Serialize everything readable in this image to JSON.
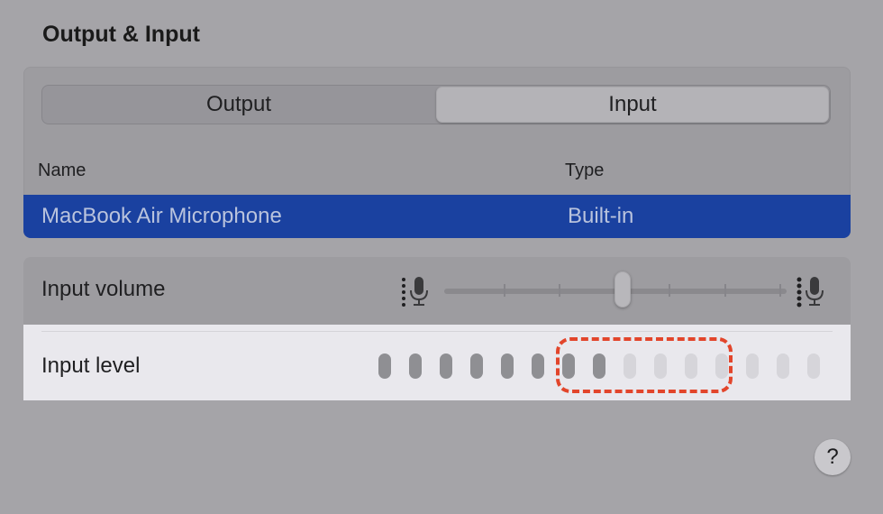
{
  "section": {
    "title": "Output & Input"
  },
  "tabs": [
    {
      "label": "Output",
      "selected": false
    },
    {
      "label": "Input",
      "selected": true
    }
  ],
  "table": {
    "headers": {
      "name": "Name",
      "type": "Type"
    },
    "rows": [
      {
        "name": "MacBook Air Microphone",
        "type": "Built-in",
        "selected": true
      }
    ]
  },
  "input_volume": {
    "label": "Input volume",
    "level_fraction": 0.52
  },
  "input_level": {
    "label": "Input level",
    "lit_segments": 8,
    "total_segments": 15
  },
  "help": {
    "label": "?"
  },
  "colors": {
    "selection": "#1a41a0",
    "highlight": "#e2452b"
  }
}
